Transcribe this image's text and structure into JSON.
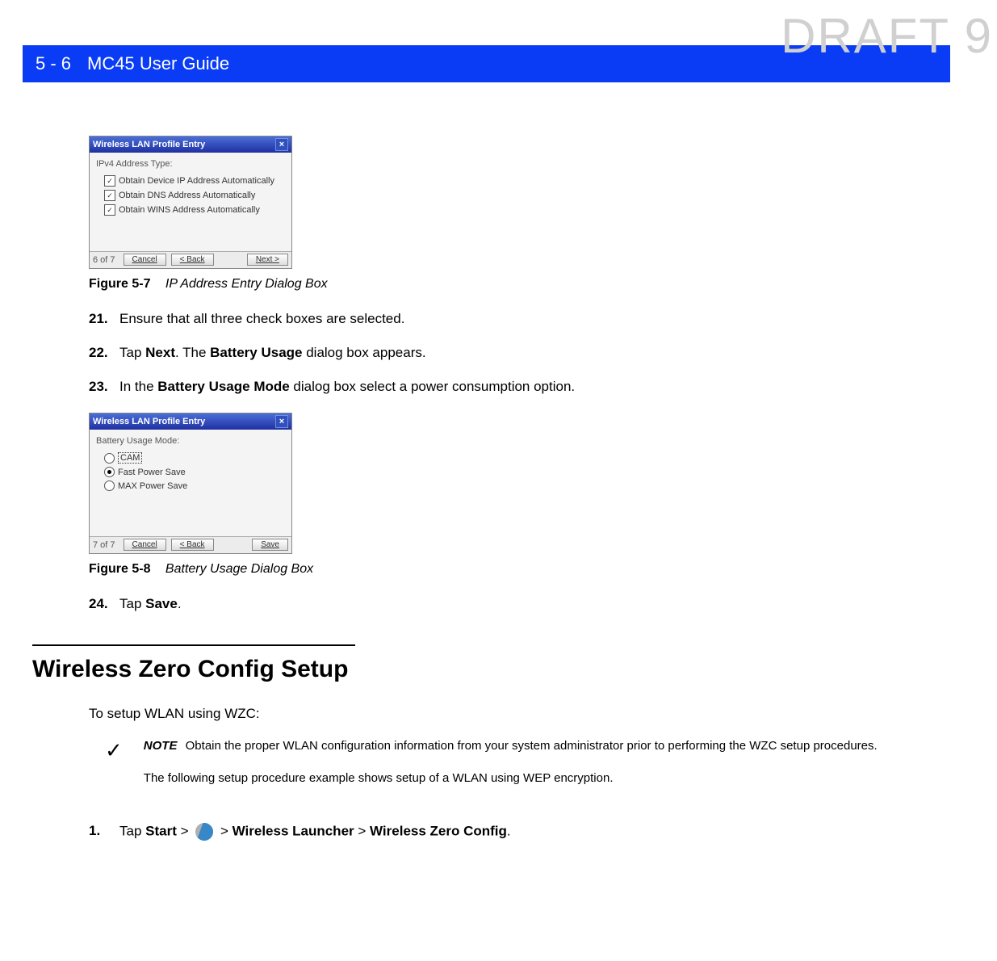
{
  "watermark": "DRAFT 9",
  "header": {
    "page_num": "5 - 6",
    "title": "MC45 User Guide"
  },
  "dialog1": {
    "title": "Wireless LAN Profile Entry",
    "close": "×",
    "label": "IPv4 Address Type:",
    "options": [
      "Obtain Device IP Address Automatically",
      "Obtain DNS Address Automatically",
      "Obtain WINS Address Automatically"
    ],
    "step_count": "6 of 7",
    "buttons": {
      "cancel": "Cancel",
      "back": "< Back",
      "next": "Next >"
    }
  },
  "figure7": {
    "label": "Figure 5-7",
    "title": "IP Address Entry Dialog Box"
  },
  "steps_a": {
    "s21_num": "21.",
    "s21_text": "Ensure that all three check boxes are selected.",
    "s22_num": "22.",
    "s22_pre": "Tap ",
    "s22_b1": "Next",
    "s22_mid": ". The ",
    "s22_b2": "Battery Usage",
    "s22_post": " dialog box appears.",
    "s23_num": "23.",
    "s23_pre": "In the ",
    "s23_b": "Battery Usage Mode",
    "s23_post": " dialog box select a power consumption option."
  },
  "dialog2": {
    "title": "Wireless LAN Profile Entry",
    "close": "×",
    "label": "Battery Usage Mode:",
    "options": [
      "CAM",
      "Fast Power Save",
      "MAX Power Save"
    ],
    "selected_index": 1,
    "highlighted_index": 0,
    "step_count": "7 of 7",
    "buttons": {
      "cancel": "Cancel",
      "back": "< Back",
      "save": "Save"
    }
  },
  "figure8": {
    "label": "Figure 5-8",
    "title": "Battery Usage Dialog Box"
  },
  "steps_b": {
    "s24_num": "24.",
    "s24_pre": "Tap ",
    "s24_b": "Save",
    "s24_post": "."
  },
  "section": {
    "heading": "Wireless Zero Config Setup",
    "intro": "To setup WLAN using WZC:"
  },
  "note": {
    "label": "NOTE",
    "line1": "Obtain the proper WLAN configuration information from your system administrator prior to performing the WZC setup procedures.",
    "line2": "The following setup procedure example shows setup of a WLAN using WEP encryption."
  },
  "steps_c": {
    "s1_num": "1.",
    "s1_pre": "Tap ",
    "s1_b1": "Start",
    "s1_sep1": " > ",
    "s1_sep2": " > ",
    "s1_b2": "Wireless Launcher",
    "s1_sep3": " > ",
    "s1_b3": "Wireless Zero Config",
    "s1_post": "."
  }
}
